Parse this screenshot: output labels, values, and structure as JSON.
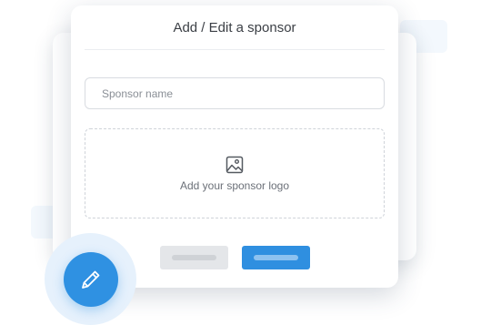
{
  "dialog": {
    "title": "Add / Edit a sponsor",
    "sponsor_name": {
      "value": "",
      "placeholder": "Sponsor name"
    },
    "logo_upload": {
      "label": "Add your sponsor logo",
      "icon": "image-icon"
    },
    "buttons": {
      "cancel": {
        "label": "",
        "color": "#e4e6e9"
      },
      "save": {
        "label": "",
        "color": "#2f8fe0"
      }
    }
  },
  "fab": {
    "icon": "pencil-icon",
    "color": "#2f91e2"
  },
  "colors": {
    "accent": "#2f8fe0"
  }
}
